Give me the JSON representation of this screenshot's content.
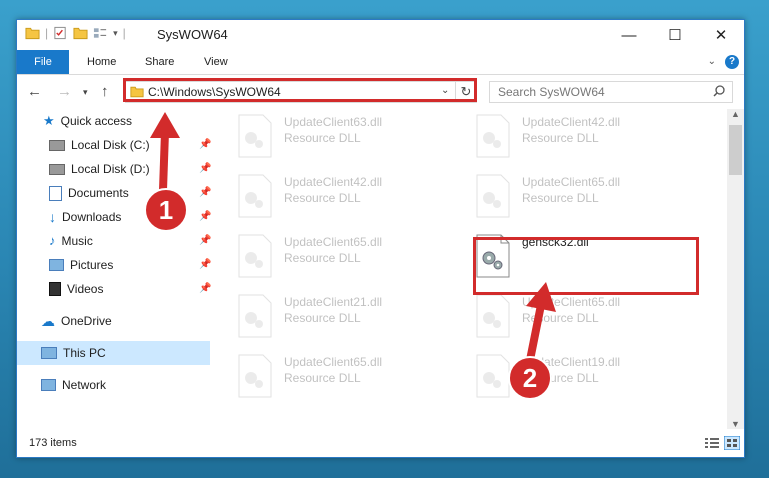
{
  "window": {
    "title": "SysWOW64"
  },
  "ribbon": {
    "file": "File",
    "home": "Home",
    "share": "Share",
    "view": "View",
    "help": "?"
  },
  "address": {
    "path": "C:\\Windows\\SysWOW64"
  },
  "search": {
    "placeholder": "Search SysWOW64"
  },
  "sidebar": {
    "items": [
      {
        "label": "Quick access"
      },
      {
        "label": "Local Disk (C:)"
      },
      {
        "label": "Local Disk (D:)"
      },
      {
        "label": "Documents"
      },
      {
        "label": "Downloads"
      },
      {
        "label": "Music"
      },
      {
        "label": "Pictures"
      },
      {
        "label": "Videos"
      },
      {
        "label": "OneDrive"
      },
      {
        "label": "This PC"
      },
      {
        "label": "Network"
      }
    ]
  },
  "files": [
    {
      "name": "UpdateClient63.dll",
      "type": "Resource DLL"
    },
    {
      "name": "UpdateClient42.dll",
      "type": "Resource DLL"
    },
    {
      "name": "UpdateClient42.dll",
      "type": "Resource DLL"
    },
    {
      "name": "UpdateClient65.dll",
      "type": "Resource DLL"
    },
    {
      "name": "UpdateClient65.dll",
      "type": "Resource DLL"
    },
    {
      "name": "gensck32.dll",
      "type": ""
    },
    {
      "name": "UpdateClient21.dll",
      "type": "Resource DLL"
    },
    {
      "name": "UpdateClient65.dll",
      "type": "Resource DLL"
    },
    {
      "name": "UpdateClient65.dll",
      "type": "Resource DLL"
    },
    {
      "name": "UpdateClient19.dll",
      "type": "Resource DLL"
    }
  ],
  "status": {
    "count": "173 items"
  },
  "annotations": {
    "step1": "1",
    "step2": "2"
  },
  "colors": {
    "accent": "#1979ca",
    "highlight": "#d22b2b",
    "selected": "#cce8ff"
  }
}
